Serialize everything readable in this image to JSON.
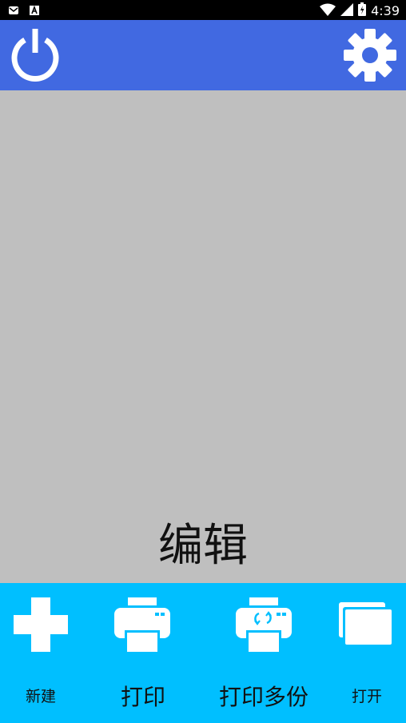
{
  "status_bar": {
    "time": "4:39",
    "icons": [
      "mail-icon",
      "a-icon",
      "wifi-icon",
      "signal-icon",
      "battery-icon"
    ]
  },
  "app_bar": {
    "color": "#4169E1",
    "left_icon": "power-icon",
    "right_icon": "gear-icon"
  },
  "canvas": {
    "color": "#BFBFBF",
    "edit_label": "编辑"
  },
  "toolbar": {
    "color": "#00BFFF",
    "items": [
      {
        "label": "新建",
        "icon": "plus-icon"
      },
      {
        "label": "打印",
        "icon": "printer-icon"
      },
      {
        "label": "打印多份",
        "icon": "printer-multiple-icon"
      },
      {
        "label": "打开",
        "icon": "window-stack-icon"
      }
    ]
  }
}
